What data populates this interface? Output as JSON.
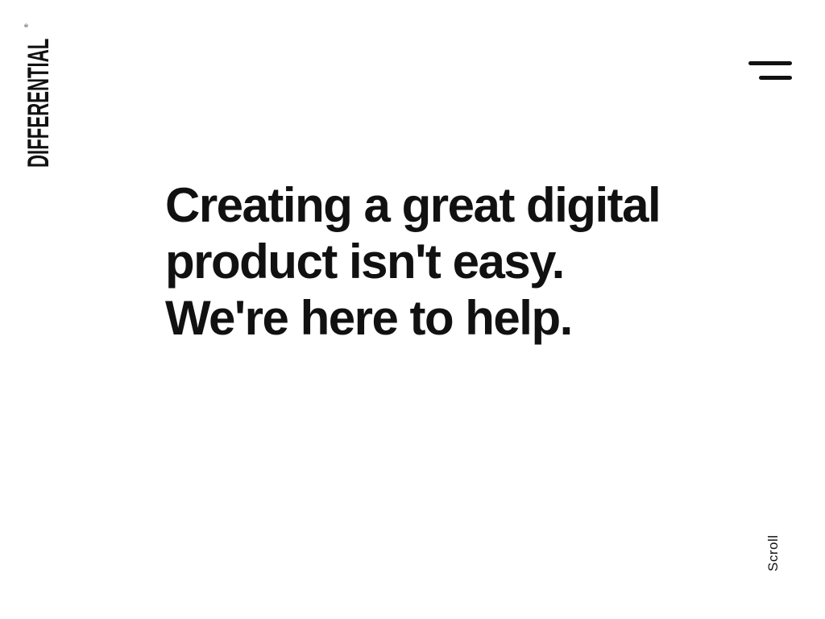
{
  "brand": {
    "name": "DIFFERENTIAL",
    "registered_mark": "®"
  },
  "nav": {
    "menu_icon": "hamburger-menu-icon"
  },
  "hero": {
    "headline": "Creating a great digital product isn't easy. We're here to help."
  },
  "scroll": {
    "label": "Scroll"
  },
  "colors": {
    "background": "#ffffff",
    "text": "#111111"
  }
}
